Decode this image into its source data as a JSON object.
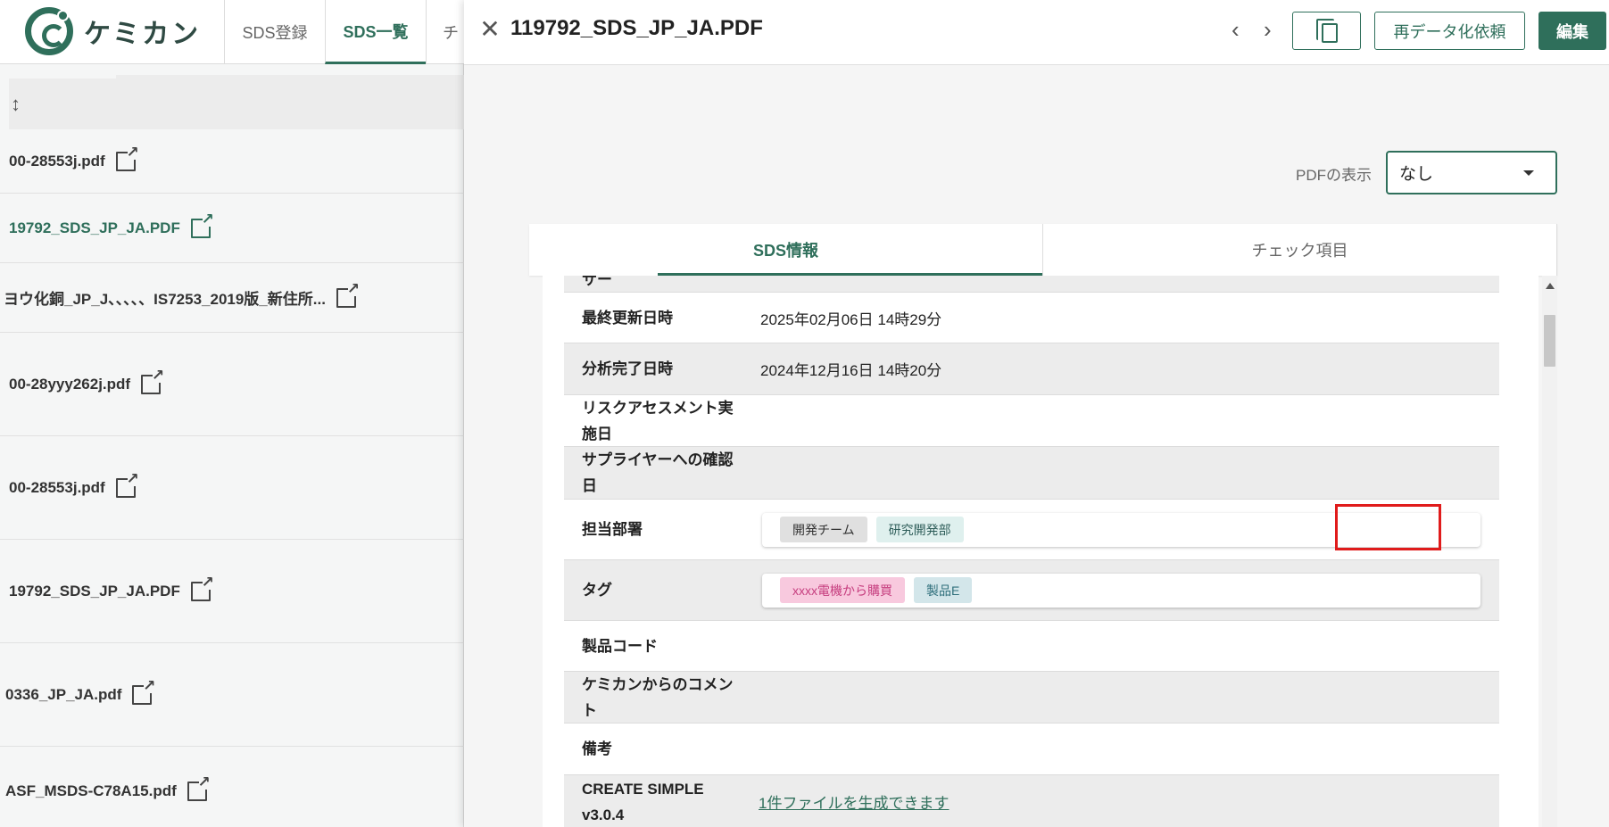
{
  "left_page": {
    "logo_text": "ケミカン",
    "nav_tabs": [
      "SDS登録",
      "SDS一覧",
      "チ"
    ],
    "active_tab": "SDS一覧",
    "column_sort_glyph": "↕",
    "file_rows": [
      {
        "name": "00-28553j.pdf",
        "link": false
      },
      {
        "name": "19792_SDS_JP_JA.PDF",
        "link": true
      },
      {
        "name": "ヨウ化銅_JP_J、、、、、IS7253_2019版_新住所...",
        "link": false
      },
      {
        "name": "00-28yyy262j.pdf",
        "link": false
      },
      {
        "name": "00-28553j.pdf",
        "link": false
      },
      {
        "name": "19792_SDS_JP_JA.PDF",
        "link": false
      },
      {
        "name": "0336_JP_JA.pdf",
        "link": false
      },
      {
        "name": "ASF_MSDS-C78A15.pdf",
        "link": false
      }
    ]
  },
  "panel": {
    "title": "119792_SDS_JP_JA.PDF",
    "close_glyph": "✕",
    "prev_glyph": "‹",
    "next_glyph": "›",
    "buttons": {
      "redata": "再データ化依頼",
      "edit": "編集"
    },
    "pdf_display": {
      "label": "PDFの表示",
      "selected": "なし"
    },
    "tabs": [
      "SDS情報",
      "チェック項目"
    ],
    "active_tab": "SDS情報",
    "rows": {
      "partial_label": "サー",
      "last_updated": {
        "label": "最終更新日時",
        "value": "2025年02月06日 14時29分"
      },
      "analysis_done": {
        "label": "分析完了日時",
        "value": "2024年12月16日 14時20分"
      },
      "risk_assessment": {
        "label": "リスクアセスメント実施日",
        "value": ""
      },
      "supplier_confirm": {
        "label": "サプライヤーへの確認日",
        "value": ""
      },
      "department": {
        "label": "担当部署",
        "chips": [
          "開発チーム",
          "研究開発部"
        ]
      },
      "tags": {
        "label": "タグ",
        "chips": [
          "xxxx電機から購買",
          "製品E"
        ]
      },
      "product_code": {
        "label": "製品コード",
        "value": ""
      },
      "comment": {
        "label": "ケミカンからのコメント",
        "value": ""
      },
      "remarks": {
        "label": "備考",
        "value": ""
      },
      "create_simple": {
        "label": "CREATE SIMPLE v3.0.4",
        "link": "1件ファイルを生成できます"
      }
    }
  },
  "colors": {
    "brand_green": "#2f6f5b",
    "highlight_red": "#e01b1b",
    "tag_pink": "#f8c9de",
    "tag_blue": "#d3e6ea"
  }
}
